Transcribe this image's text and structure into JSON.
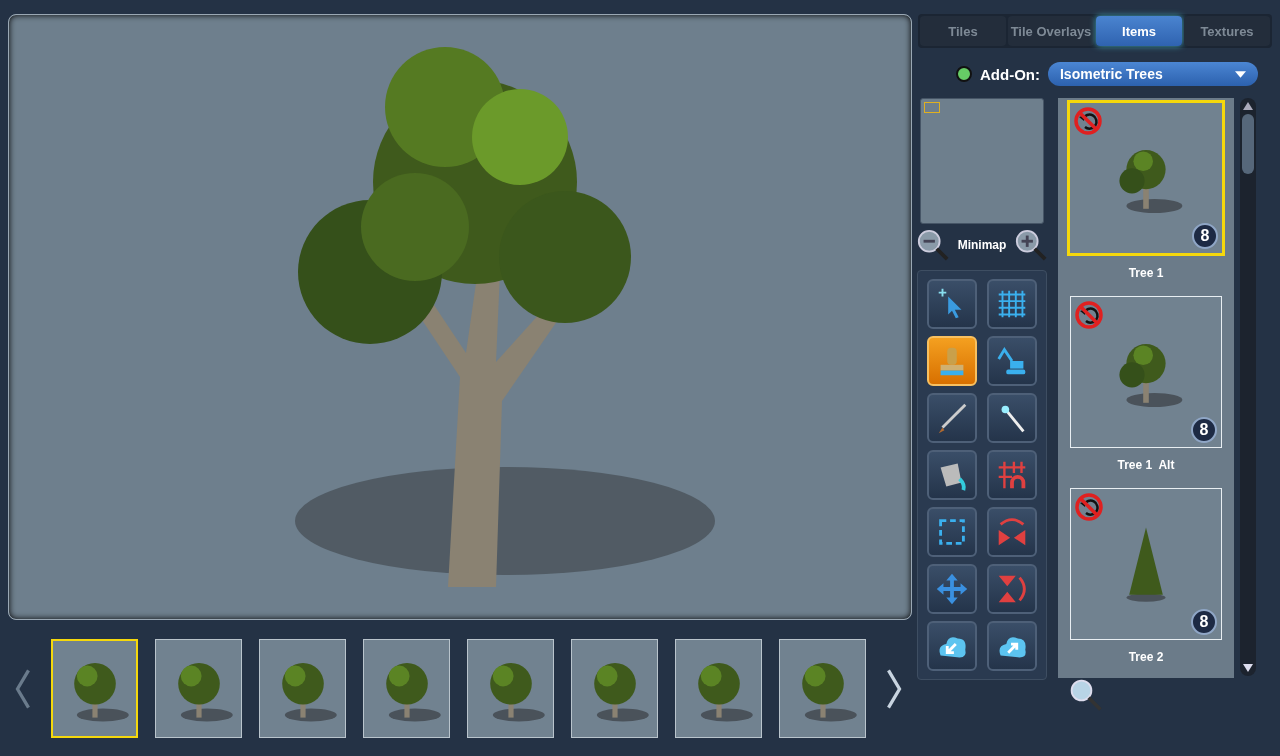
{
  "tabs": [
    {
      "label": "Tiles",
      "selected": false
    },
    {
      "label": "Tile Overlays",
      "selected": false
    },
    {
      "label": "Items",
      "selected": true
    },
    {
      "label": "Textures",
      "selected": false
    }
  ],
  "addon": {
    "label": "Add-On:",
    "value": "Isometric Trees",
    "on": true
  },
  "minimap": {
    "label": "Minimap"
  },
  "tools": [
    {
      "kind": "select",
      "selected": false
    },
    {
      "kind": "grid",
      "selected": false
    },
    {
      "kind": "stamp",
      "selected": true
    },
    {
      "kind": "excavator",
      "selected": false
    },
    {
      "kind": "brush",
      "selected": false
    },
    {
      "kind": "wand",
      "selected": false
    },
    {
      "kind": "bucket",
      "selected": false
    },
    {
      "kind": "grid-magnet",
      "selected": false
    },
    {
      "kind": "marquee",
      "selected": false
    },
    {
      "kind": "flip-horizontal",
      "selected": false
    },
    {
      "kind": "move",
      "selected": false
    },
    {
      "kind": "flip-vertical",
      "selected": false
    },
    {
      "kind": "import",
      "selected": false
    },
    {
      "kind": "export",
      "selected": false
    }
  ],
  "items": [
    {
      "name": "Tree 1",
      "badge": "8",
      "kind": "broadleaf",
      "selected": true
    },
    {
      "name": "Tree 1  Alt",
      "badge": "8",
      "kind": "broadleaf",
      "selected": false
    },
    {
      "name": "Tree 2",
      "badge": "8",
      "kind": "conifer",
      "selected": false
    }
  ],
  "thumbnails": [
    {
      "selected": true
    },
    {
      "selected": false
    },
    {
      "selected": false
    },
    {
      "selected": false
    },
    {
      "selected": false
    },
    {
      "selected": false
    },
    {
      "selected": false
    },
    {
      "selected": false
    }
  ]
}
